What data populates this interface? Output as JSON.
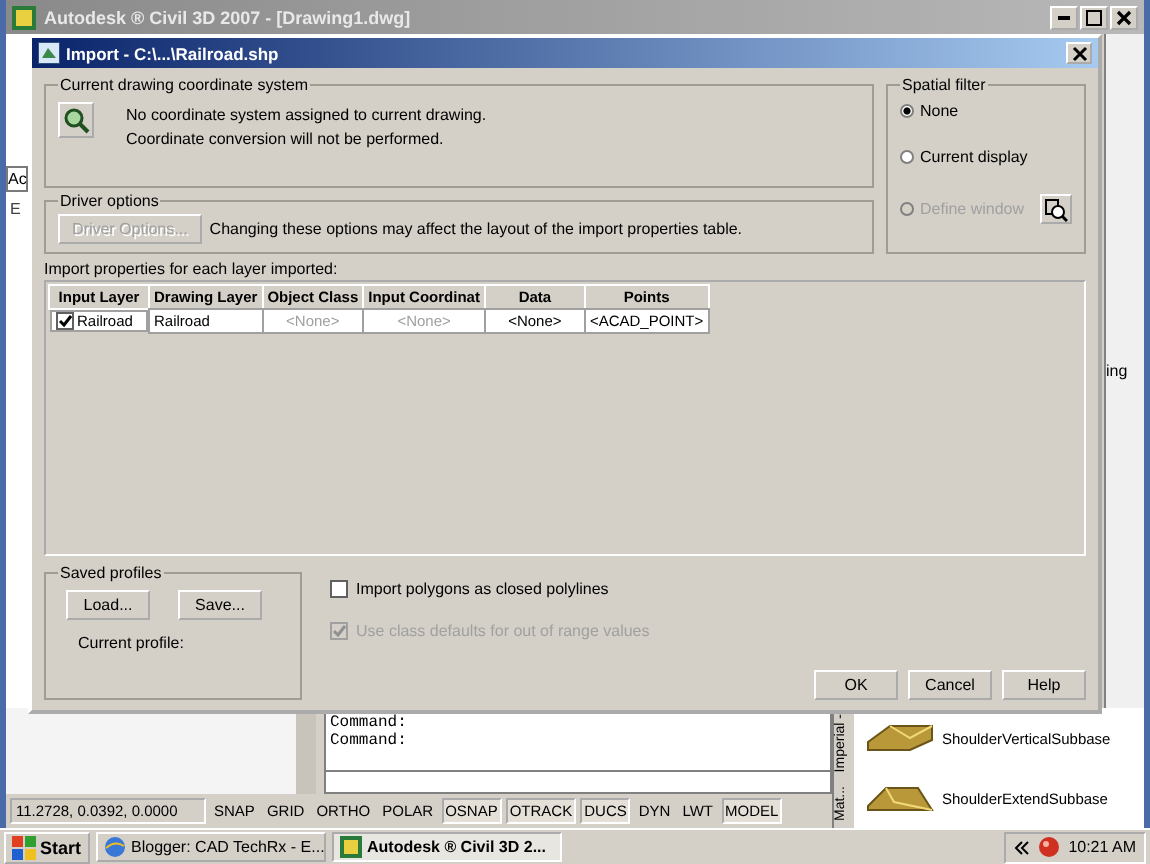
{
  "app": {
    "title": "Autodesk ® Civil 3D 2007 - [Drawing1.dwg]",
    "left_strip": [
      "Ac",
      "E"
    ],
    "right_text": "ing"
  },
  "dialog": {
    "title": "Import - C:\\...\\Railroad.shp",
    "coordinate_system": {
      "label": "Current drawing coordinate system",
      "lines": [
        "No coordinate system assigned to current drawing.",
        "Coordinate conversion will not be performed."
      ]
    },
    "driver_options": {
      "label": "Driver options",
      "button": {
        "label": "Driver Options...",
        "disabled": true
      },
      "note": "Changing these options may affect the layout of the import properties table."
    },
    "spatial_filter": {
      "label": "Spatial filter",
      "options": [
        {
          "label": "None",
          "selected": true,
          "disabled": false
        },
        {
          "label": "Current display",
          "selected": false,
          "disabled": false
        },
        {
          "label": "Define window",
          "selected": false,
          "disabled": true
        }
      ]
    },
    "table": {
      "label": "Import properties for each layer imported:",
      "columns": [
        "Input Layer",
        "Drawing Layer",
        "Object Class",
        "Input Coordinat",
        "Data",
        "Points"
      ],
      "rows": [
        {
          "checked": true,
          "cells": [
            {
              "text": "Railroad",
              "disabled": false
            },
            {
              "text": "Railroad",
              "disabled": false
            },
            {
              "text": "<None>",
              "disabled": true
            },
            {
              "text": "<None>",
              "disabled": true
            },
            {
              "text": "<None>",
              "disabled": false
            },
            {
              "text": "<ACAD_POINT>",
              "disabled": false
            }
          ]
        }
      ]
    },
    "saved_profiles": {
      "label": "Saved profiles",
      "buttons": [
        "Load...",
        "Save..."
      ],
      "current_profile": "Current profile:"
    },
    "options": [
      {
        "label": "Import polygons as closed polylines",
        "checked": false,
        "disabled": false
      },
      {
        "label": "Use class defaults for out of range values",
        "checked": true,
        "disabled": true
      }
    ],
    "buttons": [
      "OK",
      "Cancel",
      "Help"
    ]
  },
  "command_lines": [
    "Command:",
    "Command:"
  ],
  "palette": {
    "tabs": [
      "Imperial -",
      "Mat..."
    ],
    "items": [
      "ShoulderVerticalSubbase",
      "ShoulderExtendSubbase"
    ]
  },
  "status_bar": {
    "coordinates": "11.2728, 0.0392, 0.0000",
    "toggles": [
      {
        "label": "SNAP",
        "on": false
      },
      {
        "label": "GRID",
        "on": false
      },
      {
        "label": "ORTHO",
        "on": false
      },
      {
        "label": "POLAR",
        "on": false
      },
      {
        "label": "OSNAP",
        "on": true
      },
      {
        "label": "OTRACK",
        "on": true
      },
      {
        "label": "DUCS",
        "on": true
      },
      {
        "label": "DYN",
        "on": false
      },
      {
        "label": "LWT",
        "on": false
      },
      {
        "label": "MODEL",
        "on": true
      }
    ]
  },
  "taskbar": {
    "start": "Start",
    "tasks": [
      {
        "label": "Blogger: CAD TechRx - E...",
        "selected": false
      },
      {
        "label": "Autodesk ® Civil 3D 2...",
        "selected": true
      }
    ],
    "clock": "10:21 AM"
  }
}
